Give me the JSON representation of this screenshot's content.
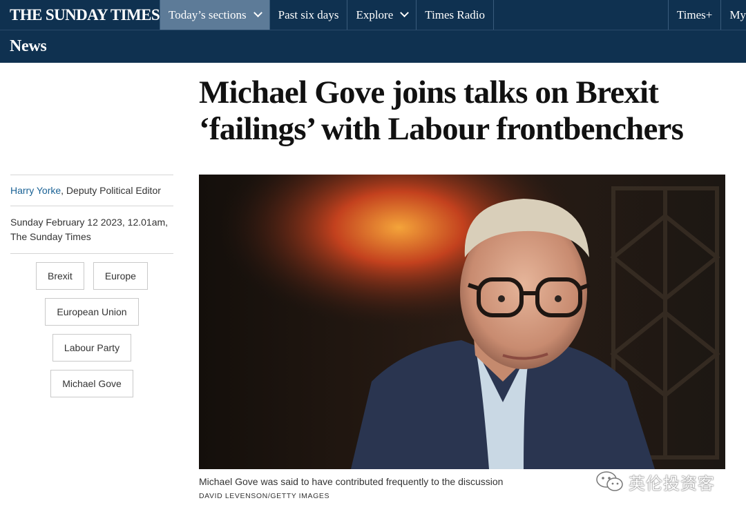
{
  "nav": {
    "logo": "THE SUNDAY TIMES",
    "items": [
      {
        "label": "Today’s sections",
        "active": true,
        "dropdown": true
      },
      {
        "label": "Past six days",
        "active": false,
        "dropdown": false
      },
      {
        "label": "Explore",
        "active": false,
        "dropdown": true
      },
      {
        "label": "Times Radio",
        "active": false,
        "dropdown": false
      }
    ],
    "right": [
      "Times+",
      "My"
    ]
  },
  "section": {
    "title": "News"
  },
  "article": {
    "headline_line1": "Michael Gove joins talks on Brexit",
    "headline_line2": "‘failings’ with Labour frontbenchers",
    "author": "Harry Yorke",
    "author_role": ", Deputy Political Editor",
    "date_line1": "Sunday February 12 2023, 12.01am,",
    "date_line2": "The Sunday Times",
    "tags": [
      "Brexit",
      "Europe",
      "European Union",
      "Labour Party",
      "Michael Gove"
    ],
    "caption": "Michael Gove was said to have contributed frequently to the discussion",
    "credit": "DAVID LEVENSON/GETTY IMAGES"
  },
  "watermark": {
    "text": "英伦投资客",
    "icon": "wechat-icon"
  },
  "colors": {
    "nav_bg": "#0f3150",
    "nav_active": "#5d7b98",
    "link": "#1a6295"
  }
}
